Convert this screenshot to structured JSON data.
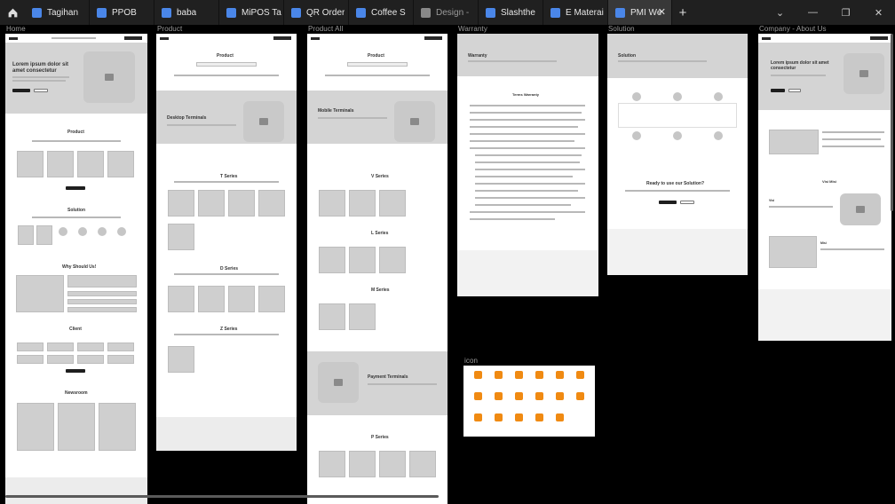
{
  "tabs": [
    {
      "label": "Tagihan",
      "color": "#4a86e8"
    },
    {
      "label": "PPOB",
      "color": "#4a86e8"
    },
    {
      "label": "baba",
      "color": "#4a86e8"
    },
    {
      "label": "MiPOS Ta",
      "color": "#4a86e8"
    },
    {
      "label": "QR Order",
      "color": "#4a86e8"
    },
    {
      "label": "Coffee S",
      "color": "#4a86e8"
    },
    {
      "label": "Design - ",
      "color": "#888888"
    },
    {
      "label": "Slashthe",
      "color": "#4a86e8"
    },
    {
      "label": "E Materai",
      "color": "#4a86e8"
    },
    {
      "label": "PMI We",
      "color": "#4a86e8"
    }
  ],
  "frames": {
    "home": "Home",
    "product": "Product",
    "product_all": "Product All",
    "warranty": "Warranty",
    "solution": "Solution",
    "company": "Company - About Us",
    "icon": "icon"
  },
  "home": {
    "hero": "Lorem ipsum dolor sit amet consectetur",
    "product": "Product",
    "solution": "Solution",
    "why": "Why Should Us!",
    "client": "Client",
    "newsroom": "Newsroom"
  },
  "product": {
    "title": "Product",
    "desktop": "Desktop Terminals",
    "t_series": "T Series",
    "d_series": "D Series",
    "z_series": "Z Series"
  },
  "product_all": {
    "title": "Product",
    "mobile": "Mobile Terminals",
    "v_series": "V Series",
    "l_series": "L Series",
    "m_series": "M Series",
    "payment": "Payment Terminals",
    "p_series": "P Series"
  },
  "warranty": {
    "title": "Warranty",
    "terms": "Terms Warranty"
  },
  "solution": {
    "title": "Solution",
    "ready": "Ready to use our Solution?"
  },
  "company": {
    "hero": "Lorem ipsum dolor sit amet consectetur",
    "vm": "Visi Misi",
    "visi": "Visi",
    "misi": "Misi"
  },
  "accent": "#f08a12"
}
